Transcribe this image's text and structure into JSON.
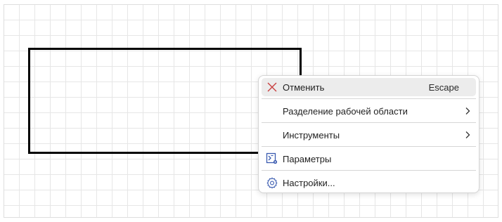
{
  "menu": {
    "items": [
      {
        "label": "Отменить",
        "shortcut": "Escape",
        "icon": "close-icon",
        "icon_color": "#c84040",
        "highlighted": true
      },
      {
        "label": "Разделение рабочей области",
        "submenu": true
      },
      {
        "label": "Инструменты",
        "submenu": true
      },
      {
        "label": "Параметры",
        "icon": "parameters-icon",
        "icon_color": "#3a5bb0"
      },
      {
        "label": "Настройки...",
        "icon": "gear-icon",
        "icon_color": "#3a5bb0"
      }
    ]
  },
  "colors": {
    "grid_line": "#e6e6e6",
    "shape_stroke": "#000000",
    "menu_highlight": "#ececec"
  }
}
